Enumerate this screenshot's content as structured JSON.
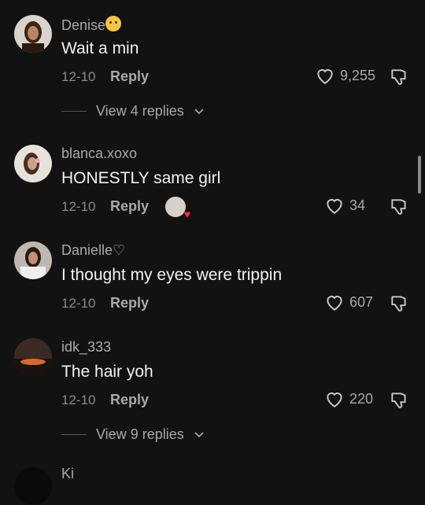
{
  "comments": [
    {
      "username": "Denise",
      "username_emoji": "smiling-face",
      "text": "Wait a min",
      "date": "12-10",
      "reply_label": "Reply",
      "likes": "9,255",
      "view_replies": "View 4 replies"
    },
    {
      "username": "blanca.xoxo",
      "text": "HONESTLY same girl",
      "date": "12-10",
      "reply_label": "Reply",
      "likes": "34"
    },
    {
      "username": "Danielle♡",
      "text": "I thought my eyes were trippin",
      "date": "12-10",
      "reply_label": "Reply",
      "likes": "607"
    },
    {
      "username": "idk_333",
      "text": "The hair yoh",
      "date": "12-10",
      "reply_label": "Reply",
      "likes": "220",
      "view_replies": "View 9 replies"
    },
    {
      "username": "Ki"
    }
  ],
  "colors": {
    "background": "#121212",
    "secondary_text": "#a9a9a9",
    "heart_accent": "#ff2d55"
  }
}
